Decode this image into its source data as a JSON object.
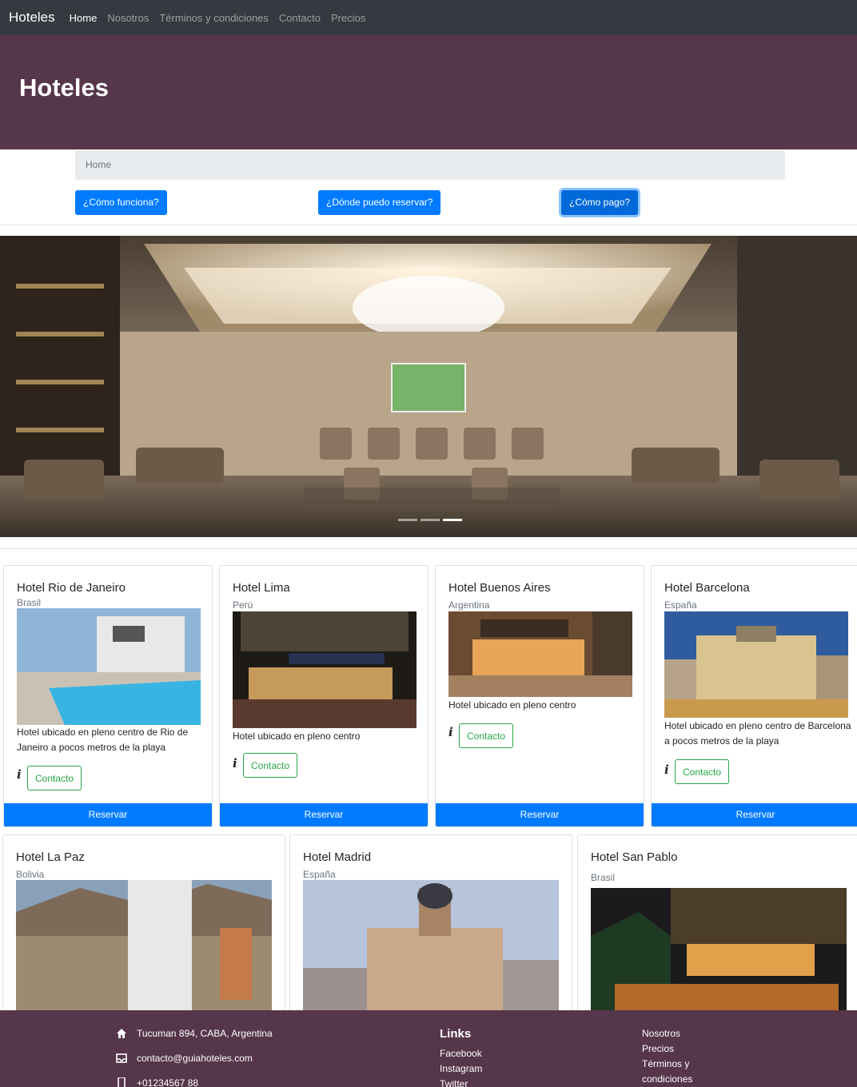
{
  "navbar": {
    "brand": "Hoteles",
    "links": [
      "Home",
      "Nosotros",
      "Términos y condiciones",
      "Contacto",
      "Precios"
    ]
  },
  "header": {
    "title": "Hoteles"
  },
  "breadcrumb": {
    "current": "Home"
  },
  "buttons": [
    "¿Cómo funciona?",
    "¿Dónde puedo reservar?",
    "¿Cómo pago?"
  ],
  "carousel": {
    "slides": 3,
    "active_slide": 3
  },
  "hotels": [
    {
      "name": "Hotel Rio de Janeiro",
      "country": "Brasil",
      "description": "Hotel ubicado en pleno centro de Rio de Janeiro a pocos metros de la playa",
      "contact": "Contacto",
      "reserve": "Reservar"
    },
    {
      "name": "Hotel Lima",
      "country": "Perú",
      "description": "Hotel ubicado en pleno centro",
      "contact": "Contacto",
      "reserve": "Reservar"
    },
    {
      "name": "Hotel Buenos Aires",
      "country": "Argentina",
      "description": "Hotel ubicado en pleno centro",
      "contact": "Contacto",
      "reserve": "Reservar"
    },
    {
      "name": "Hotel Barcelona",
      "country": "España",
      "description": "Hotel ubicado en pleno centro de Barcelona a pocos metros de la playa",
      "contact": "Contacto",
      "reserve": "Reservar"
    },
    {
      "name": "Hotel La Paz",
      "country": "Bolivia"
    },
    {
      "name": "Hotel Madrid",
      "country": "España"
    },
    {
      "name": "Hotel San Pablo",
      "country": "Brasil"
    }
  ],
  "footer": {
    "address": "Tucuman 894, CABA, Argentina",
    "email": "contacto@guiahoteles.com",
    "phone": "+01234567 88",
    "links_title": "Links",
    "links": [
      "Facebook",
      "Instagram",
      "Twitter"
    ],
    "nav": [
      "Nosotros",
      "Precios",
      "Términos y condiciones"
    ]
  },
  "colors": {
    "navbar": "#343a40",
    "header": "#56364a",
    "primary": "#007bff",
    "success": "#28a745"
  }
}
